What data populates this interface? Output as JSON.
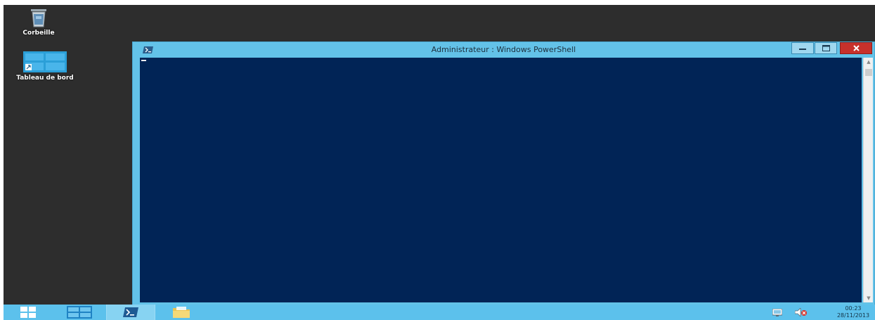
{
  "desktop": {
    "recycle_bin_label": "Corbeille",
    "dashboard_label": "Tableau de bord"
  },
  "window": {
    "title": "Administrateur : Windows PowerShell",
    "console_text": ""
  },
  "taskbar": {
    "items": [
      {
        "name": "start",
        "icon": "windows-logo-icon"
      },
      {
        "name": "dashboard",
        "icon": "dashboard-icon"
      },
      {
        "name": "powershell",
        "icon": "powershell-icon",
        "active": true
      },
      {
        "name": "explorer",
        "icon": "folder-icon"
      }
    ],
    "clock": {
      "time": "00:23",
      "date": "28/11/2013"
    }
  },
  "colors": {
    "desktop_bg": "#2d2d2d",
    "console_bg": "#012456",
    "window_frame": "#63c2e8",
    "taskbar_bg": "#5cc1ec",
    "close_button": "#c7312b"
  }
}
